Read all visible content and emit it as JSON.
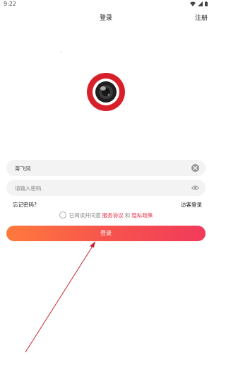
{
  "status_bar": {
    "time": "9:22"
  },
  "header": {
    "title": "登录",
    "register_label": "注册"
  },
  "logo": {
    "icon": "camera-lens-logo",
    "ring_color": "#d8202a"
  },
  "form": {
    "username": {
      "value": "菁飞网",
      "clear_icon": "clear-icon"
    },
    "password": {
      "placeholder": "请输入密码",
      "toggle_icon": "eye-icon"
    },
    "forgot_password_label": "忘记密码?",
    "guest_login_label": "访客登录",
    "agreement": {
      "checked": false,
      "prefix": "已阅读并同意",
      "terms_label": "服务协议",
      "and_label": "和",
      "privacy_label": "隐私政策"
    },
    "login_button_label": "登录"
  },
  "colors": {
    "accent": "#e8334a",
    "button_gradient_start": "#ff7a3c",
    "button_gradient_end": "#f13a5a",
    "annotation_arrow": "#c8252e"
  }
}
